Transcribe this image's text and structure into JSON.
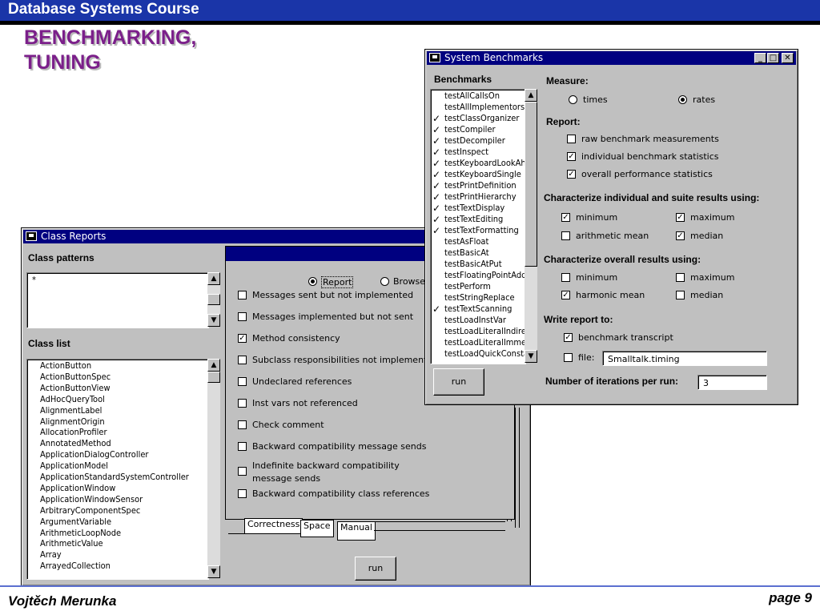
{
  "slide": {
    "course": "Database Systems Course",
    "title_line1": "BENCHMARKING,",
    "title_line2": "TUNING",
    "author": "Vojtěch Merunka",
    "page": "page 9"
  },
  "colors": {
    "header": "#1a35a8",
    "title": "#7b1f8a",
    "window_title": "#000080",
    "window_bg": "#c0c0c0"
  },
  "class_reports": {
    "title": "Class Reports",
    "class_patterns_label": "Class patterns",
    "pattern_value": "*",
    "class_list_label": "Class list",
    "classes": [
      "ActionButton",
      "ActionButtonSpec",
      "ActionButtonView",
      "AdHocQueryTool",
      "AlignmentLabel",
      "AlignmentOrigin",
      "AllocationProfiler",
      "AnnotatedMethod",
      "ApplicationDialogController",
      "ApplicationModel",
      "ApplicationStandardSystemController",
      "ApplicationWindow",
      "ApplicationWindowSensor",
      "ArbitraryComponentSpec",
      "ArgumentVariable",
      "ArithmeticLoopNode",
      "ArithmeticValue",
      "Array",
      "ArrayedCollection"
    ],
    "mode_report": "Report",
    "mode_browse": "Browse",
    "checks": [
      {
        "label": "Messages sent but not implemented",
        "checked": false
      },
      {
        "label": "Messages implemented but not sent",
        "checked": false
      },
      {
        "label": "Method consistency",
        "checked": true
      },
      {
        "label": "Subclass responsibilities not implemented",
        "checked": false
      },
      {
        "label": "Undeclared references",
        "checked": false
      },
      {
        "label": "Inst vars not referenced",
        "checked": false
      },
      {
        "label": "Check comment",
        "checked": false
      },
      {
        "label": "Backward compatibility message sends",
        "checked": false
      },
      {
        "label": "Indefinite backward compatibility",
        "label2": "message sends",
        "checked": false
      },
      {
        "label": "Backward compatibility class references",
        "checked": false
      }
    ],
    "tabs": [
      "Correctness",
      "Space",
      "Manual"
    ],
    "run_label": "run"
  },
  "system_benchmarks": {
    "title": "System Benchmarks",
    "benchmarks_label": "Benchmarks",
    "benchmarks": [
      {
        "name": "testAllCallsOn",
        "checked": false
      },
      {
        "name": "testAllImplementors",
        "checked": false
      },
      {
        "name": "testClassOrganizer",
        "checked": true
      },
      {
        "name": "testCompiler",
        "checked": true
      },
      {
        "name": "testDecompiler",
        "checked": true
      },
      {
        "name": "testInspect",
        "checked": true
      },
      {
        "name": "testKeyboardLookAhead",
        "checked": true
      },
      {
        "name": "testKeyboardSingle",
        "checked": true
      },
      {
        "name": "testPrintDefinition",
        "checked": true
      },
      {
        "name": "testPrintHierarchy",
        "checked": true
      },
      {
        "name": "testTextDisplay",
        "checked": true
      },
      {
        "name": "testTextEditing",
        "checked": true
      },
      {
        "name": "testTextFormatting",
        "checked": true
      },
      {
        "name": "testAsFloat",
        "checked": false
      },
      {
        "name": "testBasicAt",
        "checked": false
      },
      {
        "name": "testBasicAtPut",
        "checked": false
      },
      {
        "name": "testFloatingPointAdd",
        "checked": false
      },
      {
        "name": "testPerform",
        "checked": false
      },
      {
        "name": "testStringReplace",
        "checked": false
      },
      {
        "name": "testTextScanning",
        "checked": true
      },
      {
        "name": "testLoadInstVar",
        "checked": false
      },
      {
        "name": "testLoadLiteralIndirect",
        "checked": false
      },
      {
        "name": "testLoadLiteralImmediate",
        "checked": false
      },
      {
        "name": "testLoadQuickConstant",
        "checked": false
      }
    ],
    "measure_label": "Measure:",
    "measure_times": "times",
    "measure_rates": "rates",
    "report_label": "Report:",
    "report_raw": "raw benchmark measurements",
    "report_individual": "individual benchmark statistics",
    "report_overall": "overall performance statistics",
    "characterize_individual_label": "Characterize individual and suite results using:",
    "ind_minimum": "minimum",
    "ind_maximum": "maximum",
    "ind_arith": "arithmetic mean",
    "ind_median": "median",
    "characterize_overall_label": "Characterize overall results using:",
    "ov_minimum": "minimum",
    "ov_maximum": "maximum",
    "ov_harmonic": "harmonic mean",
    "ov_median": "median",
    "write_label": "Write report to:",
    "write_transcript": "benchmark transcript",
    "write_file": "file:",
    "file_value": "Smalltalk.timing",
    "iterations_label": "Number of iterations per run:",
    "iterations_value": "3",
    "run_label": "run"
  }
}
